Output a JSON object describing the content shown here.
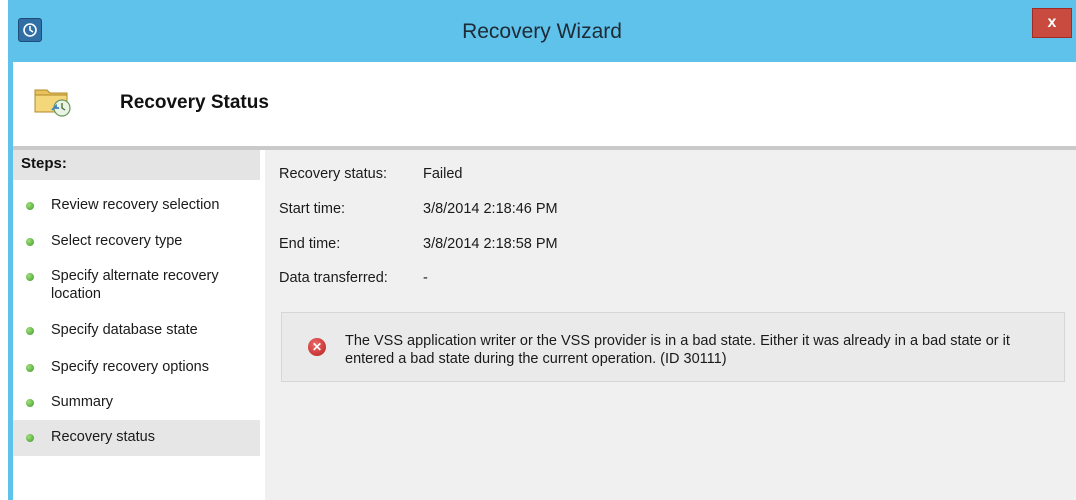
{
  "window": {
    "title": "Recovery Wizard",
    "close_glyph": "x"
  },
  "header": {
    "title": "Recovery Status"
  },
  "steps": {
    "heading": "Steps:",
    "items": [
      {
        "label": "Review recovery selection"
      },
      {
        "label": "Select recovery type"
      },
      {
        "label": "Specify alternate recovery location"
      },
      {
        "label": "Specify database state"
      },
      {
        "label": "Specify recovery options"
      },
      {
        "label": "Summary"
      },
      {
        "label": "Recovery status",
        "active": true
      }
    ]
  },
  "status": {
    "recovery_status_label": "Recovery status:",
    "recovery_status_value": "Failed",
    "start_time_label": "Start time:",
    "start_time_value": "3/8/2014 2:18:46 PM",
    "end_time_label": "End time:",
    "end_time_value": "3/8/2014 2:18:58 PM",
    "data_transferred_label": "Data transferred:",
    "data_transferred_value": "-"
  },
  "error": {
    "message": "The VSS application writer or the VSS provider is in a bad state. Either it was already in a bad state or it entered a bad state during the current operation. (ID 30111)"
  },
  "colors": {
    "titlebar": "#5ec2ea",
    "close": "#c94a3f",
    "content_bg": "#f0f0f0",
    "step_dot": "#3f9a28",
    "error_icon": "#b81e1e"
  },
  "icons": {
    "app": "clock-backup-icon",
    "header": "folder-restore-icon",
    "step": "green-dot-icon",
    "error": "error-circle-icon"
  }
}
